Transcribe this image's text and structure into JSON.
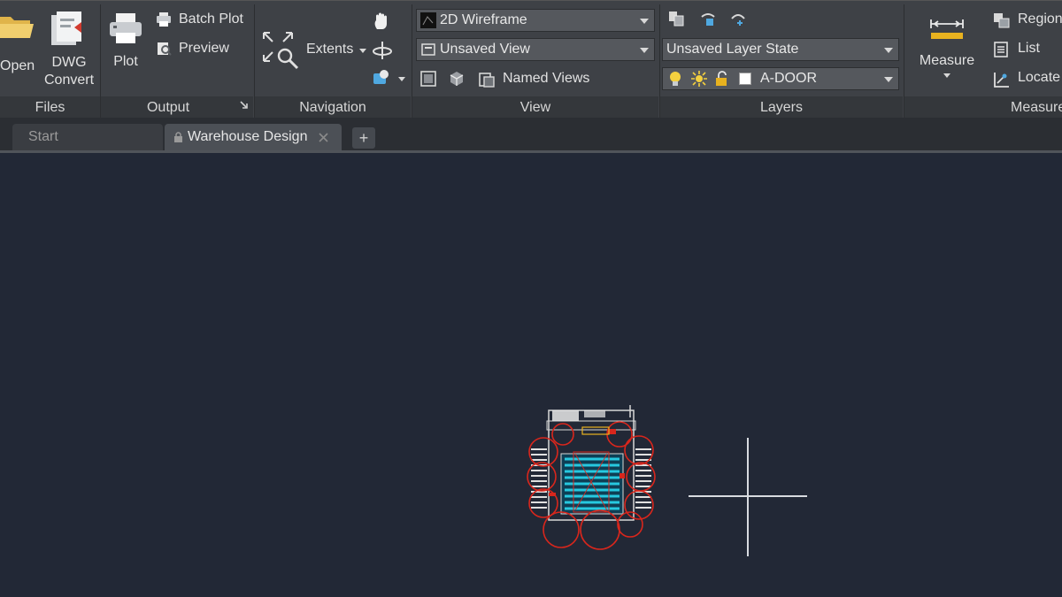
{
  "ribbon": {
    "files": {
      "title": "Files",
      "open_label": "Open",
      "dwg_convert_line1": "DWG",
      "dwg_convert_line2": "Convert"
    },
    "output": {
      "title": "Output",
      "plot_label": "Plot",
      "batch_plot_label": "Batch Plot",
      "preview_label": "Preview"
    },
    "navigation": {
      "title": "Navigation",
      "extents_label": "Extents"
    },
    "view": {
      "title": "View",
      "visual_style_value": "2D Wireframe",
      "saved_view_value": "Unsaved View",
      "named_views_label": "Named Views"
    },
    "layers": {
      "title": "Layers",
      "layer_state_value": "Unsaved Layer State",
      "current_layer_value": "A-DOOR"
    },
    "measure": {
      "title": "Measure",
      "measure_label": "Measure",
      "region_label": "Region",
      "list_label": "List",
      "locate_label": "Locate"
    }
  },
  "tabs": {
    "start_label": "Start",
    "active_label": "Warehouse Design",
    "add_label": "+"
  },
  "colors": {
    "ribbon_bg": "#3e4146",
    "canvas_bg": "#222836",
    "accent_gold": "#e8b21f",
    "drawing_red": "#d9261c",
    "drawing_cyan": "#27c9e0"
  }
}
